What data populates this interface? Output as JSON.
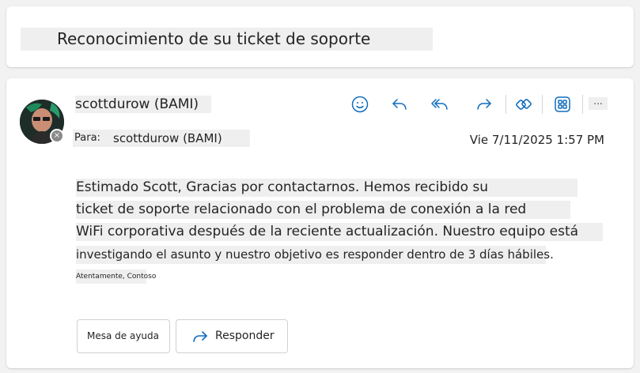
{
  "subject": "Reconocimiento de su ticket de soporte",
  "sender": {
    "name": "scottdurow (BAMI)"
  },
  "recipient": {
    "label": "Para:",
    "name": "scottdurow (BAMI)"
  },
  "date": "Vie 7/11/2025 1:57 PM",
  "toolbar": {
    "icons": [
      "smiley-icon",
      "reply-icon",
      "reply-all-icon",
      "forward-icon",
      "loop-icon",
      "apps-icon"
    ],
    "more_label": "..."
  },
  "body": {
    "line1": "Estimado Scott, Gracias por contactarnos. Hemos recibido su",
    "line2": "ticket de soporte relacionado con el problema de conexión a la red",
    "line3": "WiFi corporativa después de la reciente actualización. Nuestro equipo está",
    "line4": "investigando el asunto y nuestro objetivo es responder dentro de 3 días hábiles.",
    "signature": "Atentamente, Contoso"
  },
  "actions": {
    "helpdesk_label": "Mesa de ayuda",
    "reply_label": "Responder"
  },
  "colors": {
    "accent": "#0f6cbd",
    "highlight": "#efefef"
  }
}
